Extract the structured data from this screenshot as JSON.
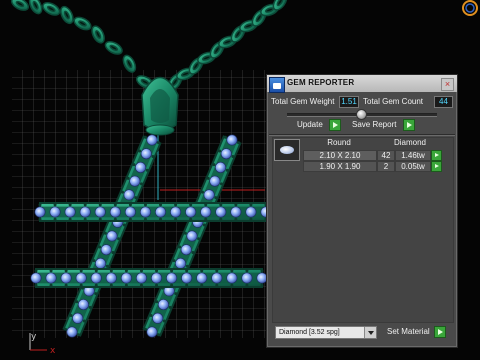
{
  "viewport": {
    "axis_y_label": "y",
    "axis_x_label": "x",
    "colors": {
      "metal": "#1f8f6f",
      "metal_dark": "#0c4a38",
      "gem": "#8fb6ff",
      "grid": "#6a6a6a",
      "axis_red": "#c02020"
    }
  },
  "gem_reporter": {
    "title": "GEM REPORTER",
    "close_icon": "close-icon",
    "total_weight_label": "Total Gem Weight",
    "total_weight_value": "1.51",
    "total_count_label": "Total Gem Count",
    "total_count_value": "44",
    "update_label": "Update",
    "save_report_label": "Save Report",
    "table": {
      "col_shape": "Round",
      "col_material": "Diamond",
      "rows": [
        {
          "size": "2.10 X 2.10",
          "count": "42",
          "weight": "1.46tw"
        },
        {
          "size": "1.90 X 1.90",
          "count": "2",
          "weight": "0.05tw"
        }
      ]
    },
    "material_select": "Diamond   [3.52 spg]",
    "set_material_label": "Set Material",
    "colors": {
      "value_text": "#52d8ff",
      "go_button": "#3aa63a"
    }
  }
}
